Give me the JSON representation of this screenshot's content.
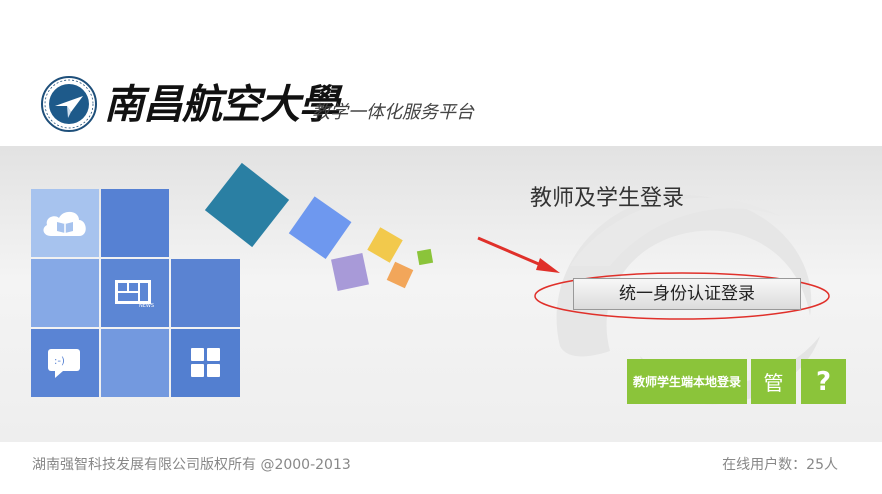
{
  "header": {
    "university_name": "南昌航空大學",
    "subtitle": "教学一体化服务平台"
  },
  "tiles": {
    "icons": [
      "cloud-book-icon",
      "news-icon",
      "chat-icon",
      "grid-icon"
    ]
  },
  "login": {
    "title": "教师及学生登录",
    "unified_login_label": "统一身份认证登录",
    "local_login_label": "教师学生端本地登录",
    "admin_label": "管",
    "help_label": "?"
  },
  "footer": {
    "copyright": "湖南强智科技发展有限公司版权所有 @2000-2013",
    "online_users": "在线用户数：25人"
  },
  "colors": {
    "tile_blue": "#5681d3",
    "green_button": "#8bc43a",
    "annotation_red": "#e0302a"
  }
}
